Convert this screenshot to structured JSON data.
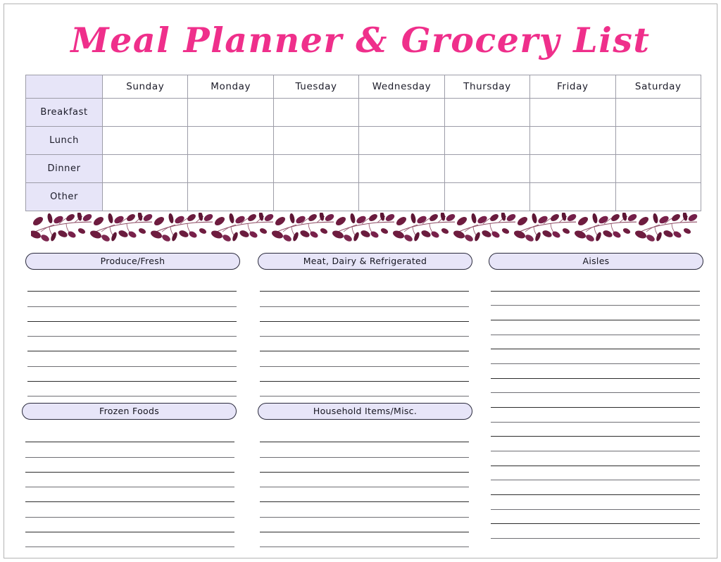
{
  "title": "Meal Planner & Grocery List",
  "colors": {
    "title_pink": "#ef2f8b",
    "lavender_fill": "#e7e5f8",
    "table_border": "#9d9da8",
    "pill_border": "#2a2a3c",
    "vine": "#7d2147",
    "page_frame": "#b4b4b4",
    "rule_line": "#2c2c2c"
  },
  "meal_table": {
    "corner_label": "",
    "days": [
      "Sunday",
      "Monday",
      "Tuesday",
      "Wednesday",
      "Thursday",
      "Friday",
      "Saturday"
    ],
    "meals": [
      "Breakfast",
      "Lunch",
      "Dinner",
      "Other"
    ],
    "cells": [
      [
        "",
        "",
        "",
        "",
        "",
        "",
        ""
      ],
      [
        "",
        "",
        "",
        "",
        "",
        "",
        ""
      ],
      [
        "",
        "",
        "",
        "",
        "",
        "",
        ""
      ],
      [
        "",
        "",
        "",
        "",
        "",
        "",
        ""
      ]
    ]
  },
  "divider": {
    "icon": "floral-vine-divider",
    "repeats": 11
  },
  "grocery": {
    "sections": [
      {
        "label": "Produce/Fresh",
        "lines": 8,
        "entries": []
      },
      {
        "label": "Meat, Dairy & Refrigerated",
        "lines": 8,
        "entries": []
      },
      {
        "label": "Aisles",
        "lines": 18,
        "entries": []
      },
      {
        "label": "Frozen Foods",
        "lines": 8,
        "entries": []
      },
      {
        "label": "Household Items/Misc.",
        "lines": 8,
        "entries": []
      }
    ]
  }
}
